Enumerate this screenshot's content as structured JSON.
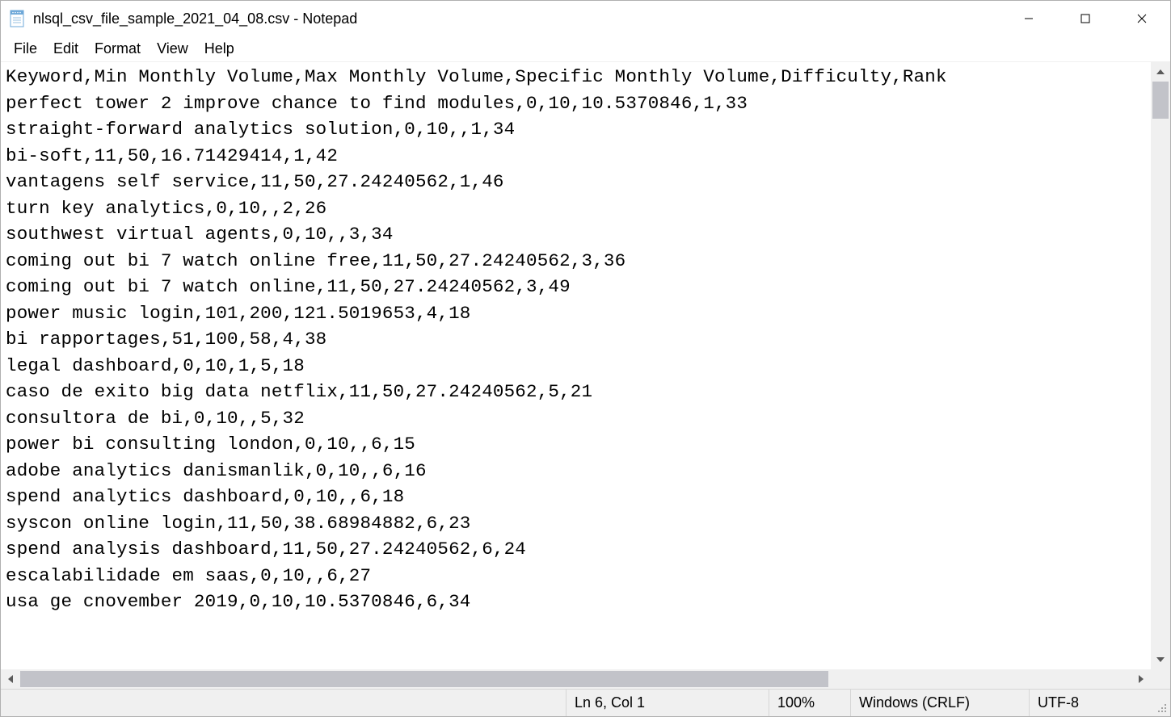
{
  "window": {
    "title": "nlsql_csv_file_sample_2021_04_08.csv - Notepad"
  },
  "menu": {
    "items": [
      "File",
      "Edit",
      "Format",
      "View",
      "Help"
    ]
  },
  "content": {
    "lines": [
      "Keyword,Min Monthly Volume,Max Monthly Volume,Specific Monthly Volume,Difficulty,Rank",
      "perfect tower 2 improve chance to find modules,0,10,10.5370846,1,33",
      "straight-forward analytics solution,0,10,,1,34",
      "bi-soft,11,50,16.71429414,1,42",
      "vantagens self service,11,50,27.24240562,1,46",
      "turn key analytics,0,10,,2,26",
      "southwest virtual agents,0,10,,3,34",
      "coming out bi 7 watch online free,11,50,27.24240562,3,36",
      "coming out bi 7 watch online,11,50,27.24240562,3,49",
      "power music login,101,200,121.5019653,4,18",
      "bi rapportages,51,100,58,4,38",
      "legal dashboard,0,10,1,5,18",
      "caso de exito big data netflix,11,50,27.24240562,5,21",
      "consultora de bi,0,10,,5,32",
      "power bi consulting london,0,10,,6,15",
      "adobe analytics danismanlik,0,10,,6,16",
      "spend analytics dashboard,0,10,,6,18",
      "syscon online login,11,50,38.68984882,6,23",
      "spend analysis dashboard,11,50,27.24240562,6,24",
      "escalabilidade em saas,0,10,,6,27",
      "usa ge cnovember 2019,0,10,10.5370846,6,34"
    ]
  },
  "status": {
    "position": "Ln 6, Col 1",
    "zoom": "100%",
    "eol": "Windows (CRLF)",
    "encoding": "UTF-8"
  }
}
